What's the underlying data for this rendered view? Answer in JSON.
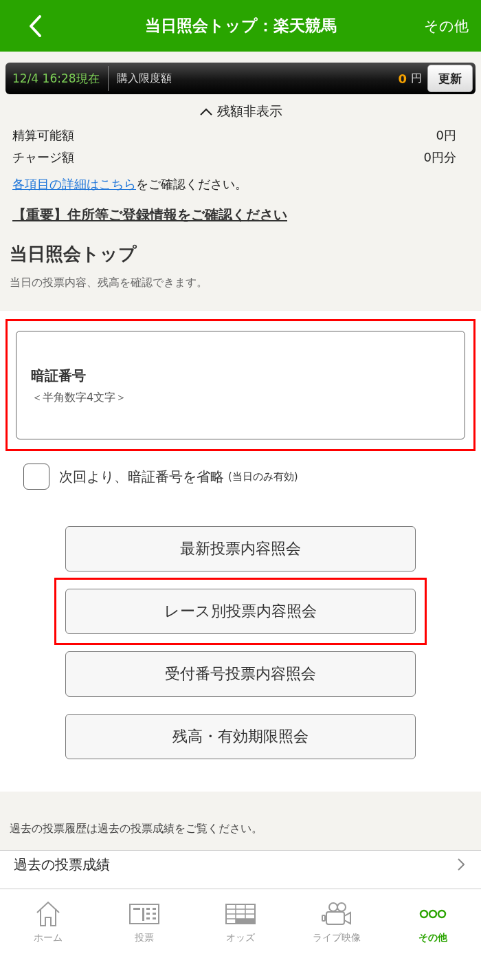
{
  "header": {
    "back_icon": true,
    "title": "当日照会トップ：楽天競馬",
    "menu": "その他"
  },
  "balance_bar": {
    "timestamp": "12/4 16:28現在",
    "label": "購入限度額",
    "amount": "0",
    "unit": "円",
    "refresh": "更新"
  },
  "balance_toggle": {
    "label": "残額非表示",
    "expanded": true
  },
  "balances": [
    {
      "label": "精算可能額",
      "value": "0円"
    },
    {
      "label": "チャージ額",
      "value": "0円分"
    }
  ],
  "details_note": {
    "link": "各項目の詳細はこちら",
    "text": "をご確認ください。"
  },
  "important_link": "【重要】住所等ご登録情報をご確認ください",
  "page_heading": "当日照会トップ",
  "page_subtitle": "当日の投票内容、残高を確認できます。",
  "pin_field": {
    "label": "暗証番号",
    "placeholder": "＜半角数字4文字＞",
    "highlighted": true
  },
  "skip_pin": {
    "label": "次回より、暗証番号を省略",
    "note": "(当日のみ有効)",
    "checked": false
  },
  "buttons": [
    {
      "label": "最新投票内容照会",
      "highlighted": false
    },
    {
      "label": "レース別投票内容照会",
      "highlighted": true
    },
    {
      "label": "受付番号投票内容照会",
      "highlighted": false
    },
    {
      "label": "残高・有効期限照会",
      "highlighted": false
    }
  ],
  "history_note": "過去の投票履歴は過去の投票成績をご覧ください。",
  "history_row": {
    "label": "過去の投票成績"
  },
  "tab_bar": [
    {
      "label": "ホーム",
      "selected": false
    },
    {
      "label": "投票",
      "selected": false
    },
    {
      "label": "オッズ",
      "selected": false
    },
    {
      "label": "ライブ映像",
      "selected": false
    },
    {
      "label": "その他",
      "selected": true
    }
  ]
}
